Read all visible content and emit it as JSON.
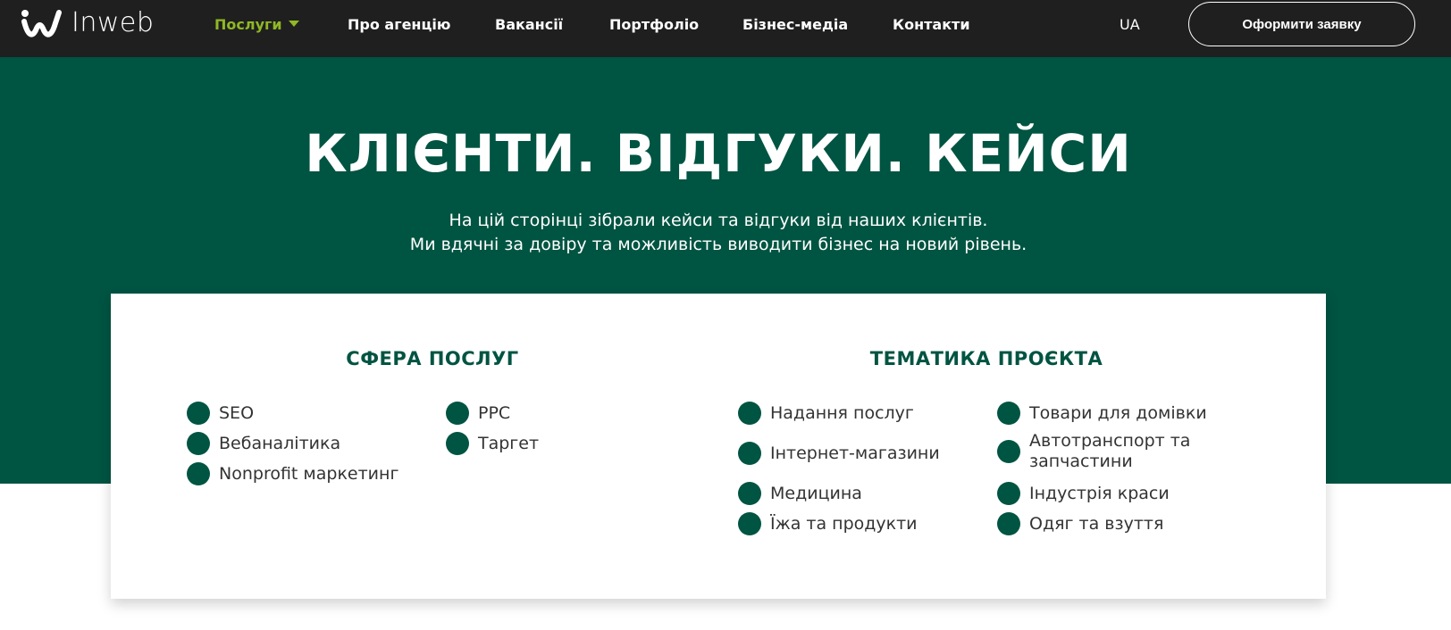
{
  "header": {
    "logo_text": "Inweb",
    "nav": [
      {
        "label": "Послуги",
        "active": true
      },
      {
        "label": "Про агенцію"
      },
      {
        "label": "Вакансії"
      },
      {
        "label": "Портфоліо"
      },
      {
        "label": "Бізнес-медіа"
      },
      {
        "label": "Контакти"
      }
    ],
    "lang": "UA",
    "cta_label": "Оформити заявку"
  },
  "hero": {
    "title": "КЛІЄНТИ. ВІДГУКИ. КЕЙСИ",
    "subtitle_line1": "На цій сторінці зібрали кейси та відгуки від наших клієнтів.",
    "subtitle_line2": "Ми вдячні за довіру та можливість виводити бізнес на новий рівень."
  },
  "filters": {
    "services": {
      "title": "СФЕРА ПОСЛУГ",
      "items": [
        "SEO",
        "Вебаналітика",
        "Nonprofit маркетинг",
        "PPC",
        "Таргет"
      ]
    },
    "topics": {
      "title": "ТЕМАТИКА ПРОЄКТА",
      "items": [
        "Надання послуг",
        "Інтернет-магазини",
        "Медицина",
        "Їжа та продукти",
        "Товари для домівки",
        "Автотранспорт та запчастини",
        "Індустрія краси",
        "Одяг та взуття"
      ]
    }
  },
  "colors": {
    "header_bg": "#1f1f1f",
    "brand_green": "#005442",
    "accent_lime": "#8fb824"
  }
}
